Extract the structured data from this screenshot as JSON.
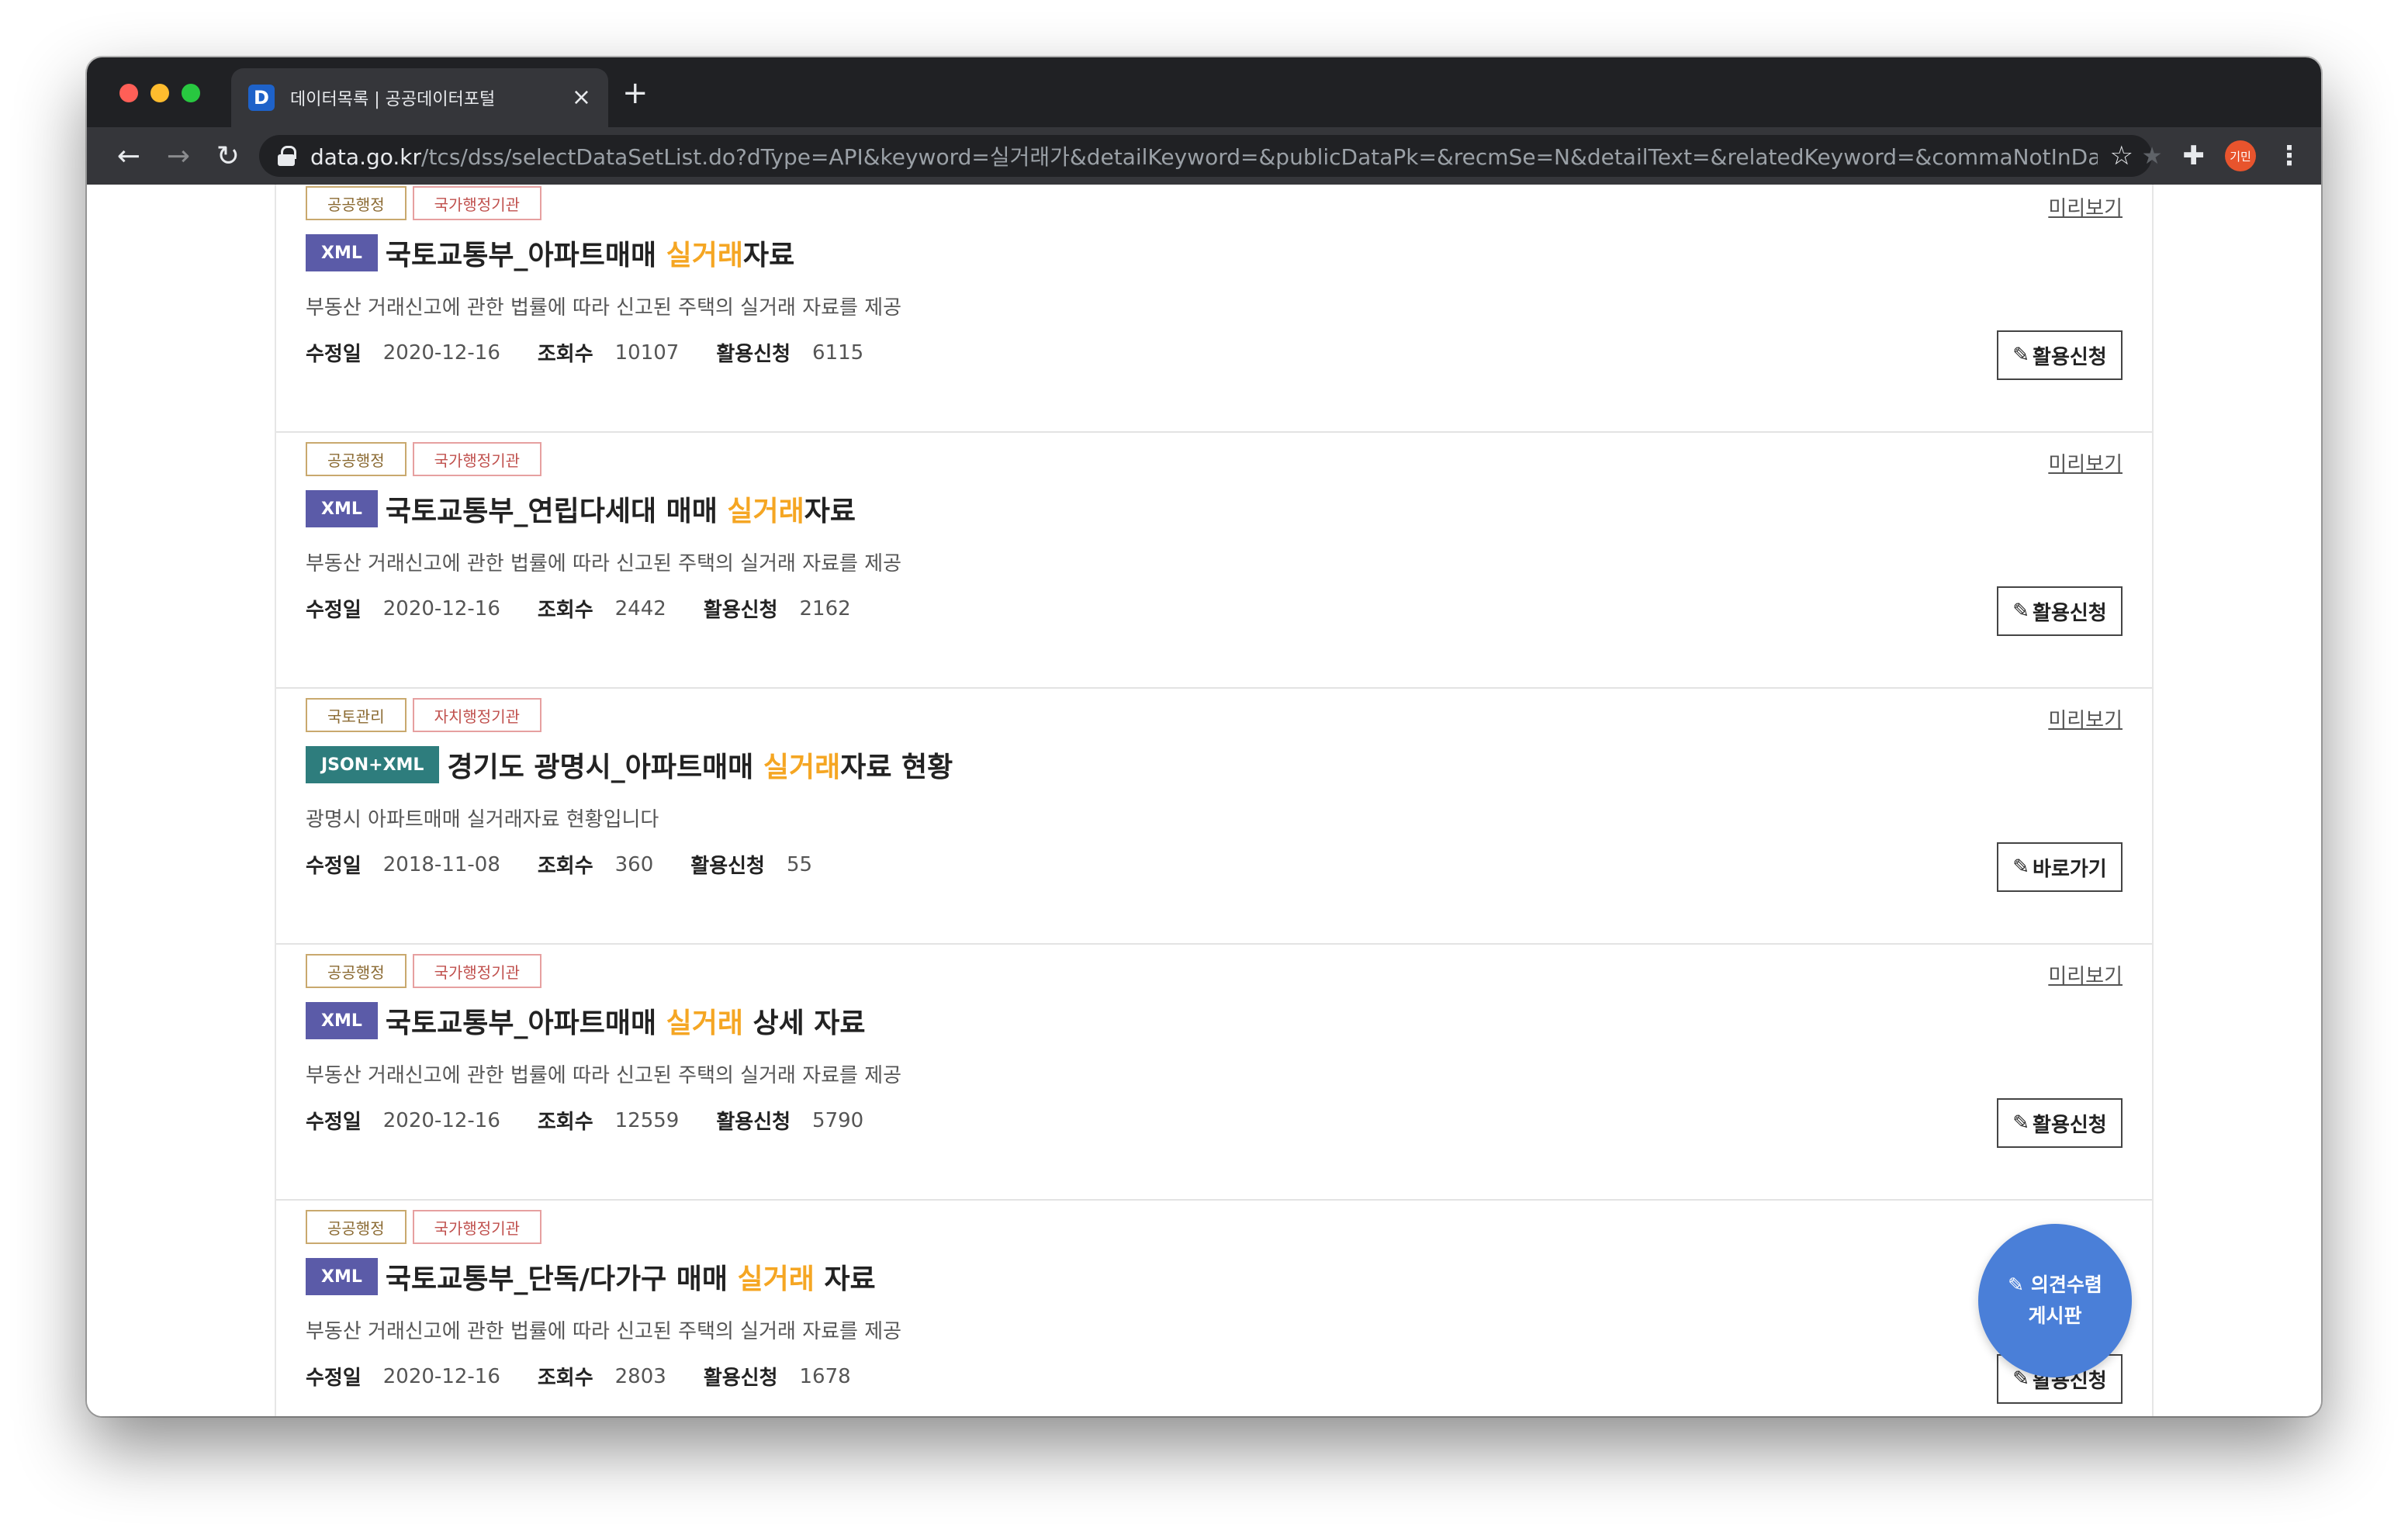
{
  "browser": {
    "tab_title": "데이터목록 | 공공데이터포털",
    "favicon_letter": "D",
    "tab_close": "×",
    "new_tab": "+",
    "url_host": "data.go.kr",
    "url_path": "/tcs/dss/selectDataSetList.do?dType=API&keyword=실거래가&detailKeyword=&publicDataPk=&recmSe=N&detailText=&relatedKeyword=&commaNotInData=&...",
    "avatar_label": "기민",
    "back_icon": "←",
    "forward_icon": "→",
    "reload_icon": "↻",
    "bookmark_icon": "☆",
    "ext_icon": "★",
    "puzzle_icon": "✚",
    "menu_icon": "⋮",
    "traffic_colors": [
      "#ff5f57",
      "#febc2e",
      "#28c840"
    ]
  },
  "labels": {
    "modified": "수정일",
    "views": "조회수",
    "applications": "활용신청",
    "preview": "미리보기",
    "pencil": "✎"
  },
  "items": [
    {
      "category": "공공행정",
      "org_type": "국가행정기관",
      "format": "XML",
      "format_color": "#5b5ba8",
      "title_pre": "국토교통부_아파트매매 ",
      "title_hl": "실거래",
      "title_post": "자료",
      "desc": "부동산 거래신고에 관한 법률에 따라 신고된 주택의 실거래 자료를 제공",
      "modified": "2020-12-16",
      "views": "10107",
      "applications": "6115",
      "action": "활용신청"
    },
    {
      "category": "공공행정",
      "org_type": "국가행정기관",
      "format": "XML",
      "format_color": "#5b5ba8",
      "title_pre": "국토교통부_연립다세대 매매 ",
      "title_hl": "실거래",
      "title_post": "자료",
      "desc": "부동산 거래신고에 관한 법률에 따라 신고된 주택의 실거래 자료를 제공",
      "modified": "2020-12-16",
      "views": "2442",
      "applications": "2162",
      "action": "활용신청"
    },
    {
      "category": "국토관리",
      "org_type": "자치행정기관",
      "format": "JSON+XML",
      "format_color": "#2e7d7d",
      "title_pre": "경기도 광명시_아파트매매 ",
      "title_hl": "실거래",
      "title_post": "자료 현황",
      "desc": "광명시 아파트매매 실거래자료 현황입니다",
      "modified": "2018-11-08",
      "views": "360",
      "applications": "55",
      "action": "바로가기"
    },
    {
      "category": "공공행정",
      "org_type": "국가행정기관",
      "format": "XML",
      "format_color": "#5b5ba8",
      "title_pre": "국토교통부_아파트매매 ",
      "title_hl": "실거래",
      "title_post": " 상세 자료",
      "desc": "부동산 거래신고에 관한 법률에 따라 신고된 주택의 실거래 자료를 제공",
      "modified": "2020-12-16",
      "views": "12559",
      "applications": "5790",
      "action": "활용신청"
    },
    {
      "category": "공공행정",
      "org_type": "국가행정기관",
      "format": "XML",
      "format_color": "#5b5ba8",
      "title_pre": "국토교통부_단독/다가구 매매 ",
      "title_hl": "실거래",
      "title_post": " 자료",
      "desc": "부동산 거래신고에 관한 법률에 따라 신고된 주택의 실거래 자료를 제공",
      "modified": "2020-12-16",
      "views": "2803",
      "applications": "1678",
      "action": "활용신청"
    }
  ],
  "fab": {
    "line1": "의견수렴",
    "line2": "게시판",
    "color": "#4a7fd8"
  }
}
